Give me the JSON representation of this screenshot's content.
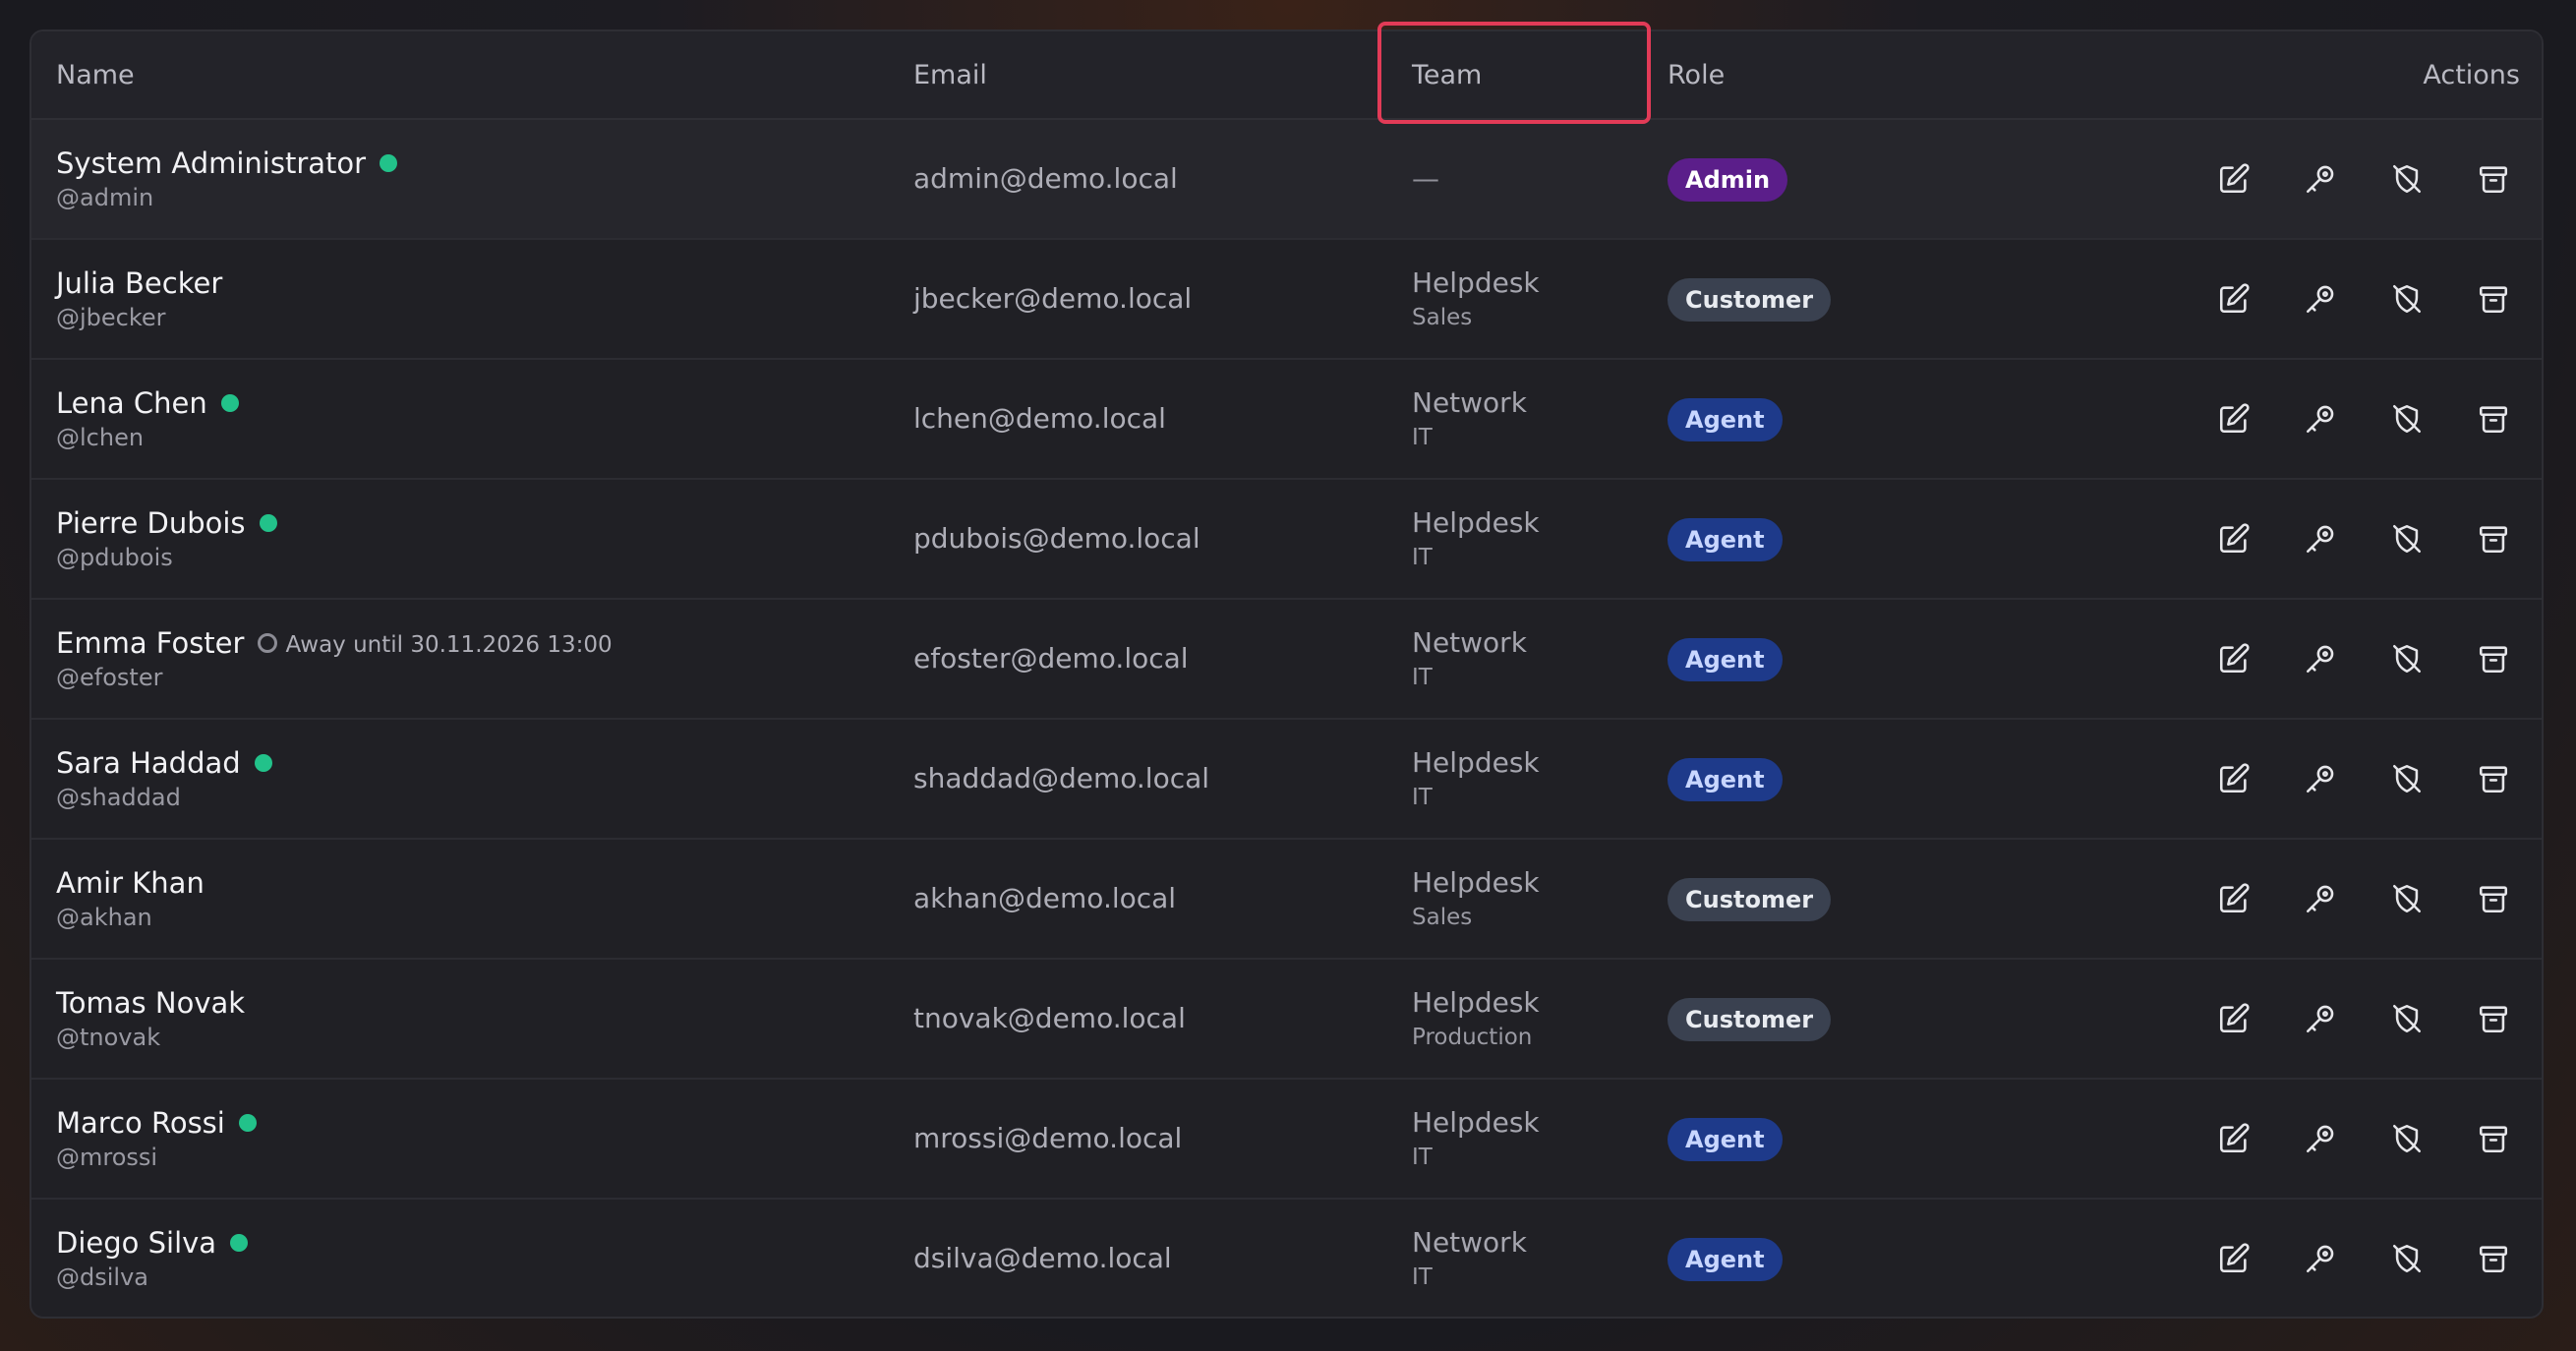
{
  "table": {
    "headers": {
      "name": "Name",
      "email": "Email",
      "team": "Team",
      "role": "Role",
      "actions": "Actions"
    },
    "rows": [
      {
        "name": "System Administrator",
        "username": "@admin",
        "status": "online",
        "away_text": "",
        "email": "admin@demo.local",
        "team": "—",
        "department": "",
        "role": "Admin"
      },
      {
        "name": "Julia Becker",
        "username": "@jbecker",
        "status": "none",
        "away_text": "",
        "email": "jbecker@demo.local",
        "team": "Helpdesk",
        "department": "Sales",
        "role": "Customer"
      },
      {
        "name": "Lena Chen",
        "username": "@lchen",
        "status": "online",
        "away_text": "",
        "email": "lchen@demo.local",
        "team": "Network",
        "department": "IT",
        "role": "Agent"
      },
      {
        "name": "Pierre Dubois",
        "username": "@pdubois",
        "status": "online",
        "away_text": "",
        "email": "pdubois@demo.local",
        "team": "Helpdesk",
        "department": "IT",
        "role": "Agent"
      },
      {
        "name": "Emma Foster",
        "username": "@efoster",
        "status": "away",
        "away_text": "Away until 30.11.2026 13:00",
        "email": "efoster@demo.local",
        "team": "Network",
        "department": "IT",
        "role": "Agent"
      },
      {
        "name": "Sara Haddad",
        "username": "@shaddad",
        "status": "online",
        "away_text": "",
        "email": "shaddad@demo.local",
        "team": "Helpdesk",
        "department": "IT",
        "role": "Agent"
      },
      {
        "name": "Amir Khan",
        "username": "@akhan",
        "status": "none",
        "away_text": "",
        "email": "akhan@demo.local",
        "team": "Helpdesk",
        "department": "Sales",
        "role": "Customer"
      },
      {
        "name": "Tomas Novak",
        "username": "@tnovak",
        "status": "none",
        "away_text": "",
        "email": "tnovak@demo.local",
        "team": "Helpdesk",
        "department": "Production",
        "role": "Customer"
      },
      {
        "name": "Marco Rossi",
        "username": "@mrossi",
        "status": "online",
        "away_text": "",
        "email": "mrossi@demo.local",
        "team": "Helpdesk",
        "department": "IT",
        "role": "Agent"
      },
      {
        "name": "Diego Silva",
        "username": "@dsilva",
        "status": "online",
        "away_text": "",
        "email": "dsilva@demo.local",
        "team": "Network",
        "department": "IT",
        "role": "Agent"
      }
    ],
    "row_actions": [
      "edit-icon",
      "key-icon",
      "disable-shield-icon",
      "archive-icon"
    ]
  },
  "colors": {
    "online": "#22c28a",
    "highlight": "#e23b57",
    "role_admin_bg": "#5b1e8a",
    "role_admin_fg": "#ffffff",
    "role_agent_bg": "#1e3a8a",
    "role_agent_fg": "#c8d6ff",
    "role_customer_bg": "#3a4150",
    "role_customer_fg": "#e8ebf0"
  }
}
